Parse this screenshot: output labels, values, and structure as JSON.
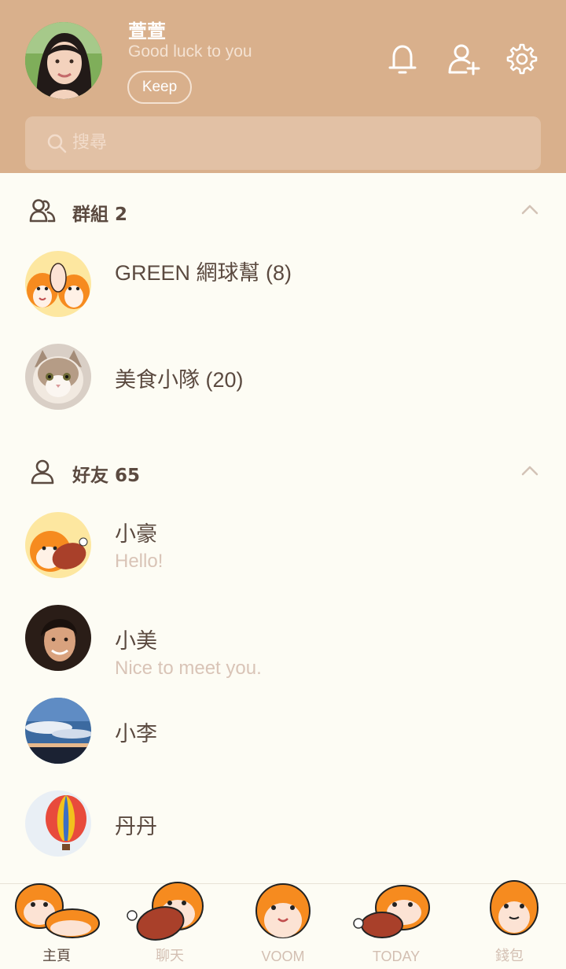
{
  "profile": {
    "name": "萱萱",
    "status": "Good luck to you",
    "keep_label": "Keep"
  },
  "header_icons": [
    "bell-icon",
    "add-friend-icon",
    "gear-icon"
  ],
  "search": {
    "placeholder": "搜尋"
  },
  "groups": {
    "title": "群組 2",
    "items": [
      {
        "name": "GREEN 網球幫 (8)"
      },
      {
        "name": "美食小隊 (20)"
      }
    ]
  },
  "friends": {
    "title": "好友 65",
    "items": [
      {
        "name": "小豪",
        "status": "Hello!"
      },
      {
        "name": "小美",
        "status": "Nice to meet you."
      },
      {
        "name": "小李"
      },
      {
        "name": "丹丹"
      }
    ]
  },
  "tabs": [
    {
      "label": "主頁",
      "active": true
    },
    {
      "label": "聊天"
    },
    {
      "label": "VOOM"
    },
    {
      "label": "TODAY"
    },
    {
      "label": "錢包"
    }
  ],
  "colors": {
    "header_bg": "#d9b08c",
    "body_bg": "#fdfcf4",
    "text_primary": "#5b4a40",
    "text_secondary": "#d9c4b7"
  }
}
